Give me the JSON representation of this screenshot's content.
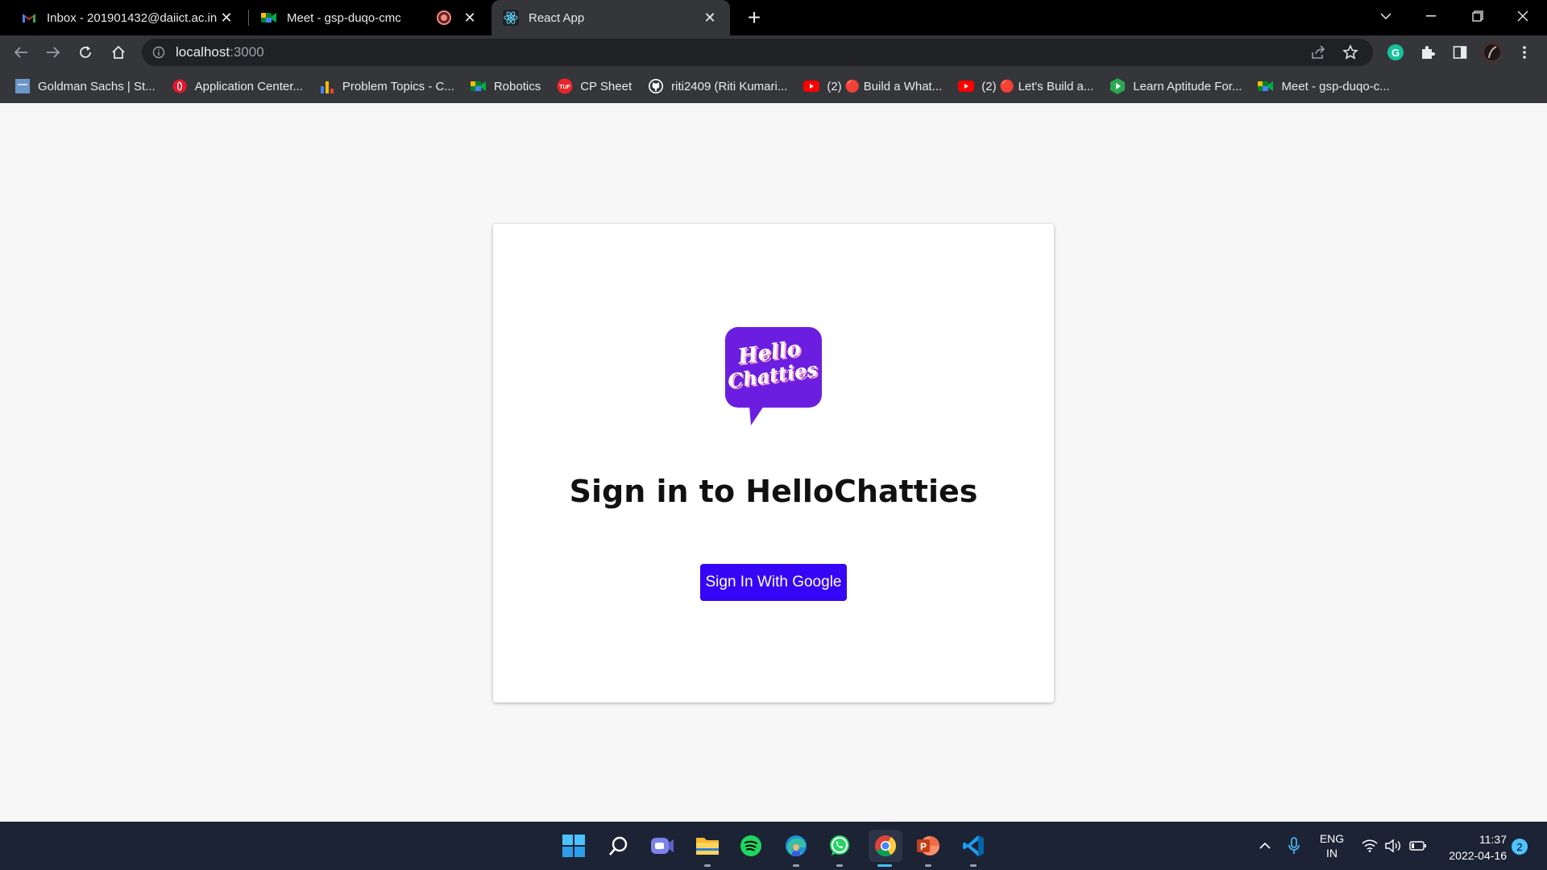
{
  "tabs": [
    {
      "title": "Inbox - 201901432@daiict.ac.in -",
      "icon": "gmail-icon"
    },
    {
      "title": "Meet - gsp-duqo-cmc",
      "icon": "google-meet-icon",
      "recording": true
    },
    {
      "title": "React App",
      "icon": "react-icon",
      "active": true
    }
  ],
  "address_bar": {
    "host": "localhost",
    "port": ":3000"
  },
  "bookmarks": [
    {
      "label": "Goldman Sachs | St...",
      "icon": "goldman-sachs-icon"
    },
    {
      "label": "Application Center...",
      "icon": "opera-icon"
    },
    {
      "label": "Problem Topics - C...",
      "icon": "bar-chart-icon"
    },
    {
      "label": "Robotics",
      "icon": "google-meet-icon"
    },
    {
      "label": "CP Sheet",
      "icon": "tuf-icon"
    },
    {
      "label": "riti2409 (Riti Kumari...",
      "icon": "github-icon"
    },
    {
      "label": "(2) 🔴 Build a What...",
      "icon": "youtube-icon"
    },
    {
      "label": "(2) 🔴 Let's Build a...",
      "icon": "youtube-icon"
    },
    {
      "label": "Learn Aptitude For...",
      "icon": "green-play-icon"
    },
    {
      "label": "Meet - gsp-duqo-c...",
      "icon": "google-meet-icon"
    }
  ],
  "signin": {
    "logo_line1": "Hello",
    "logo_line2": "Chatties",
    "title": "Sign in to HelloChatties",
    "button_label": "Sign In With Google"
  },
  "taskbar": {
    "apps": [
      "windows-start-icon",
      "search-icon",
      "teams-chat-icon",
      "file-explorer-icon",
      "spotify-icon",
      "edge-icon",
      "whatsapp-icon",
      "chrome-icon",
      "powerpoint-icon",
      "vscode-icon"
    ],
    "language_line1": "ENG",
    "language_line2": "IN",
    "time": "11:37",
    "date": "2022-04-16",
    "notification_count": "2"
  },
  "colors": {
    "accent": "#3605f5",
    "logo_purple": "#6c1ee0",
    "chrome_dark": "#35363a"
  }
}
